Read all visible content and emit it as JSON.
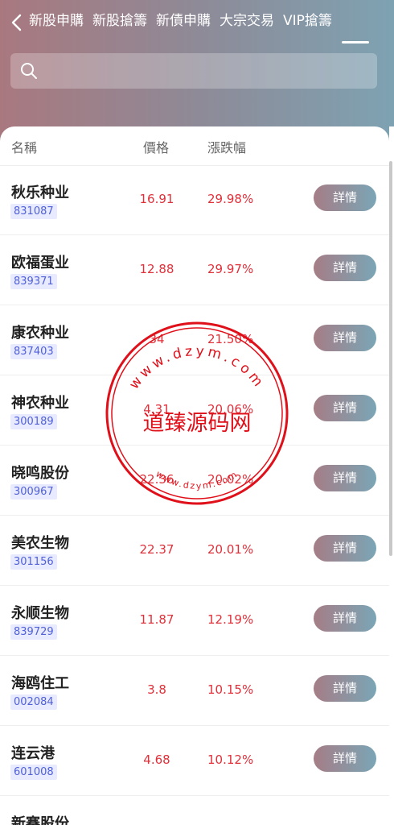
{
  "tabs": [
    {
      "label": "新股申購"
    },
    {
      "label": "新股搶籌"
    },
    {
      "label": "新債申購"
    },
    {
      "label": "大宗交易"
    },
    {
      "label": "VIP搶籌"
    }
  ],
  "active_tab": 4,
  "search": {
    "placeholder": ""
  },
  "table": {
    "headers": {
      "name": "名稱",
      "price": "價格",
      "change": "漲跌幅"
    },
    "detail_label": "詳情",
    "rows": [
      {
        "name": "秋乐种业",
        "code": "831087",
        "price": "16.91",
        "change": "29.98%"
      },
      {
        "name": "欧福蛋业",
        "code": "839371",
        "price": "12.88",
        "change": "29.97%"
      },
      {
        "name": "康农种业",
        "code": "837403",
        "price": "34",
        "change": "21.50%"
      },
      {
        "name": "神农种业",
        "code": "300189",
        "price": "4.31",
        "change": "20.06%"
      },
      {
        "name": "晓鸣股份",
        "code": "300967",
        "price": "22.36",
        "change": "20.02%"
      },
      {
        "name": "美农生物",
        "code": "301156",
        "price": "22.37",
        "change": "20.01%"
      },
      {
        "name": "永顺生物",
        "code": "839729",
        "price": "11.87",
        "change": "12.19%"
      },
      {
        "name": "海鸥住工",
        "code": "002084",
        "price": "3.8",
        "change": "10.15%"
      },
      {
        "name": "连云港",
        "code": "601008",
        "price": "4.68",
        "change": "10.12%"
      },
      {
        "name": "新赛股份",
        "code": "",
        "price": "",
        "change": ""
      }
    ]
  },
  "watermark": {
    "center_text": "道臻源码网",
    "top_arc": "www.dzym.com",
    "bottom_arc": "www.dzym.com",
    "color": "#e0101a"
  },
  "colors": {
    "accent_red": "#e0303a",
    "code_blue": "#5060d8",
    "button_gradient_start": "#a57d86",
    "button_gradient_end": "#7aa6b6"
  }
}
